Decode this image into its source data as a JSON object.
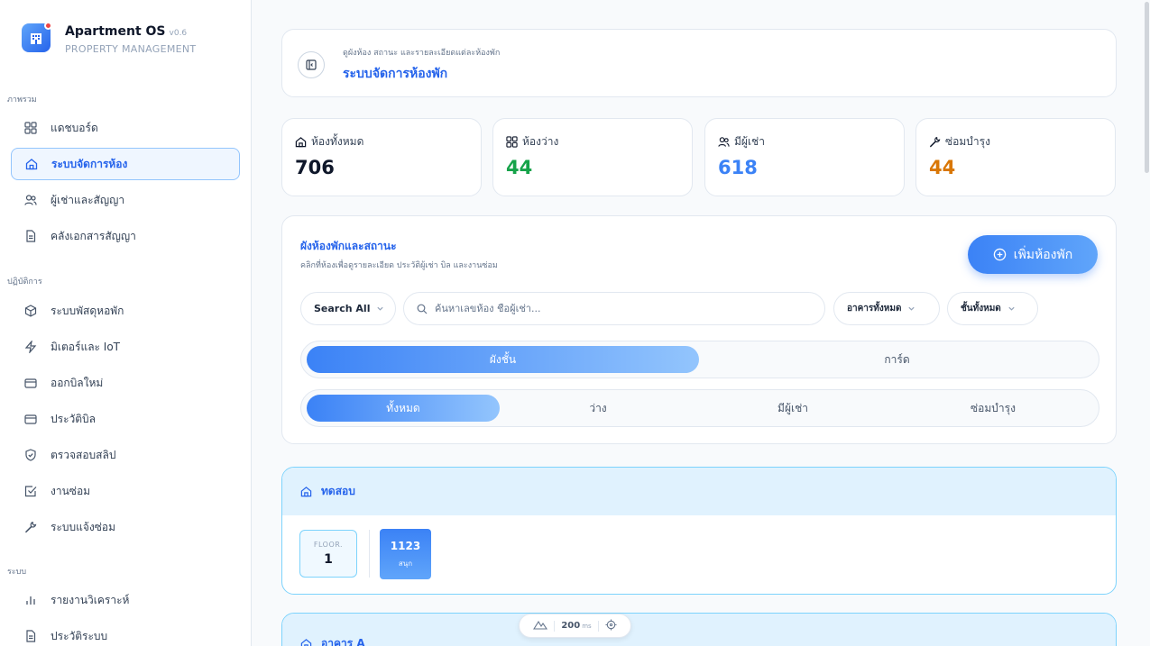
{
  "brand": {
    "title": "Apartment OS",
    "version": "v0.6",
    "subtitle": "PROPERTY MANAGEMENT"
  },
  "sidebar": {
    "sections": [
      "ภาพรวม",
      "ปฏิบัติการ",
      "ระบบ"
    ],
    "items": [
      {
        "label": "แดชบอร์ด",
        "icon": "grid-icon",
        "active": false
      },
      {
        "label": "ระบบจัดการห้อง",
        "icon": "home-icon",
        "active": true
      },
      {
        "label": "ผู้เช่าและสัญญา",
        "icon": "users-icon",
        "active": false
      },
      {
        "label": "คลังเอกสารสัญญา",
        "icon": "document-icon",
        "active": false
      },
      {
        "label": "ระบบพัสดุหอพัก",
        "icon": "package-icon",
        "active": false
      },
      {
        "label": "มิเตอร์และ IoT",
        "icon": "bolt-icon",
        "active": false
      },
      {
        "label": "ออกบิลใหม่",
        "icon": "card-icon",
        "active": false
      },
      {
        "label": "ประวัติบิล",
        "icon": "card-icon",
        "active": false
      },
      {
        "label": "ตรวจสอบสลิป",
        "icon": "shield-check-icon",
        "active": false
      },
      {
        "label": "งานซ่อม",
        "icon": "checkbox-icon",
        "active": false
      },
      {
        "label": "ระบบแจ้งซ่อม",
        "icon": "wrench-icon",
        "active": false
      },
      {
        "label": "รายงานวิเคราะห์",
        "icon": "bar-chart-icon",
        "active": false
      },
      {
        "label": "ประวัติระบบ",
        "icon": "document-icon",
        "active": false
      }
    ]
  },
  "header": {
    "subtitle": "ดูผังห้อง สถานะ และรายละเอียดแต่ละห้องพัก",
    "title": "ระบบจัดการห้องพัก"
  },
  "stats": [
    {
      "label": "ห้องทั้งหมด",
      "value": "706",
      "icon": "home-icon",
      "color": "#0f172a"
    },
    {
      "label": "ห้องว่าง",
      "value": "44",
      "icon": "grid-icon",
      "color": "#16a34a"
    },
    {
      "label": "มีผู้เช่า",
      "value": "618",
      "icon": "users-icon",
      "color": "#3b82f6"
    },
    {
      "label": "ซ่อมบำรุง",
      "value": "44",
      "icon": "wrench-icon",
      "color": "#d97706"
    }
  ],
  "map": {
    "title": "ผังห้องพักและสถานะ",
    "subtitle": "คลิกที่ห้องเพื่อดูรายละเอียด ประวัติผู้เช่า บิล และงานซ่อม",
    "add_button": "เพิ่มห้องพัก",
    "search_scope": "Search All",
    "search_placeholder": "ค้นหาเลขห้อง ชื่อผู้เช่า...",
    "building_filter": "อาคารทั้งหมด",
    "floor_filter": "ชั้นทั้งหมด",
    "view_tabs": [
      "ผังชั้น",
      "การ์ด"
    ],
    "status_tabs": [
      "ทั้งหมด",
      "ว่าง",
      "มีผู้เช่า",
      "ซ่อมบำรุง"
    ]
  },
  "buildings": [
    {
      "name": "ทดสอบ",
      "floors": [
        {
          "label": "FLOOR.",
          "number": "1",
          "rooms": [
            {
              "number": "1123",
              "status": "สนุก"
            }
          ]
        }
      ]
    },
    {
      "name": "อาคาร A"
    }
  ],
  "overlay": {
    "value": "200",
    "unit": "ms"
  }
}
